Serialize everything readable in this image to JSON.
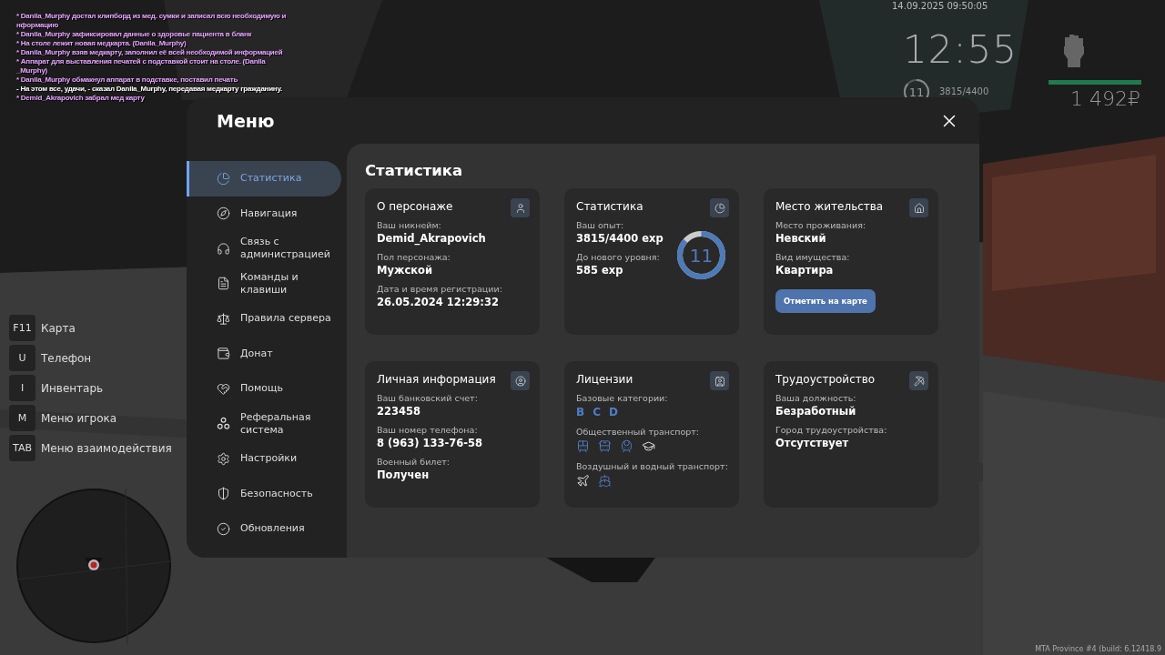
{
  "chat": [
    {
      "lines": [
        "* Danila_Murphy достал клипборд из мед. сумки и записал всю необходимую и",
        "нформацию"
      ],
      "color": "#e7a3ff"
    },
    {
      "lines": [
        "* Danila_Murphy зафиксировал данные о здоровье пациента в бланк"
      ],
      "color": "#e7a3ff"
    },
    {
      "lines": [
        "* На столе лежит новая медкарта. (Danila_Murphy)"
      ],
      "color": "#e7a3ff"
    },
    {
      "lines": [
        "* Danila_Murphy взяв медкарту, заполнил её всей необходимой информацией"
      ],
      "color": "#e7a3ff"
    },
    {
      "lines": [
        "* Аппарат для выставления печатей с подставкой стоит на столе. (Danila",
        "_Murphy)"
      ],
      "color": "#e7a3ff"
    },
    {
      "lines": [
        "* Danila_Murphy обмакнул аппарат в подставке, поставил печать"
      ],
      "color": "#e7a3ff"
    },
    {
      "lines": [
        "- На этом все, удачи, - сказал Danila_Murphy, передавая медкарту гражданину."
      ],
      "color": "#ffffff"
    },
    {
      "lines": [
        "* Demid_Akrapovich забрал мед карту"
      ],
      "color": "#e7a3ff"
    }
  ],
  "hud": {
    "datetime": "14.09.2025 09:50:05",
    "time": "12:55",
    "level": "11",
    "exp": "3815/4400",
    "exp_ring": {
      "level": 0.867
    },
    "health": {
      "level": 1
    },
    "money": "1 492₽"
  },
  "keybinds": [
    {
      "key": "F11",
      "label": "Карта"
    },
    {
      "key": "U",
      "label": "Телефон"
    },
    {
      "key": "I",
      "label": "Инвентарь"
    },
    {
      "key": "M",
      "label": "Меню игрока"
    },
    {
      "key": "TAB",
      "label": "Меню взаимодействия"
    }
  ],
  "menu": {
    "title": "Меню",
    "sidebar": [
      {
        "label": "Статистика",
        "selected": true
      },
      {
        "label": "Навигация",
        "selected": false
      },
      {
        "label": "Связь с администрацией",
        "selected": false
      },
      {
        "label": "Команды и клавиши",
        "selected": false
      },
      {
        "label": "Правила сервера",
        "selected": false
      },
      {
        "label": "Донат",
        "selected": false
      },
      {
        "label": "Помощь",
        "selected": false
      },
      {
        "label": "Реферальная система",
        "selected": false
      },
      {
        "label": "Настройки",
        "selected": false
      },
      {
        "label": "Безопасность",
        "selected": false
      },
      {
        "label": "Обновления",
        "selected": false
      }
    ],
    "page_title": "Статистика",
    "cards": [
      {
        "kind": "fields",
        "title": "О персонаже",
        "fields": [
          {
            "label": "Ваш никнейм:",
            "value": "Demid_Akrapovich"
          },
          {
            "label": "Пол персонажа:",
            "value": "Мужской"
          },
          {
            "label": "Дата и время регистрации:",
            "value": "26.05.2024 12:29:32"
          }
        ]
      },
      {
        "kind": "level",
        "title": "Статистика",
        "fields": [
          {
            "label": "Ваш опыт:",
            "value": "3815/4400 exp"
          },
          {
            "label": "До нового уровня:",
            "value": "585 exp"
          }
        ],
        "ring": {
          "text": "11",
          "level": 0.867
        }
      },
      {
        "kind": "fields",
        "title": "Место жительства",
        "fields": [
          {
            "label": "Место проживания:",
            "value": "Невский"
          },
          {
            "label": "Вид имущества:",
            "value": "Квартира"
          }
        ],
        "button": "Отметить на карте"
      },
      {
        "kind": "fields",
        "title": "Личная информация",
        "fields": [
          {
            "label": "Ваш банковский счет:",
            "value": "223458"
          },
          {
            "label": "Ваш номер телефона:",
            "value": "8 (963) 133-76-58"
          },
          {
            "label": "Военный билет:",
            "value": "Получен"
          }
        ]
      },
      {
        "kind": "licenses",
        "title": "Лицензии",
        "base_label": "Базовые категории:",
        "categories": [
          "B",
          "C",
          "D"
        ],
        "groups": [
          {
            "label": "Общественный транспорт:",
            "vehicles": [
              {
                "owned": true
              },
              {
                "owned": true
              },
              {
                "owned": true
              },
              {
                "owned": false
              }
            ]
          },
          {
            "label": "Воздушный и водный транспорт:",
            "vehicles": [
              {
                "owned": false
              },
              {
                "owned": true
              }
            ]
          }
        ]
      },
      {
        "kind": "fields",
        "title": "Трудоустройство",
        "fields": [
          {
            "label": "Ваша должность:",
            "value": "Безработный"
          },
          {
            "label": "Город трудоустройства:",
            "value": "Отсутствует"
          }
        ]
      }
    ]
  },
  "footer": "MTA Province #4 (build: 6.12418.9"
}
